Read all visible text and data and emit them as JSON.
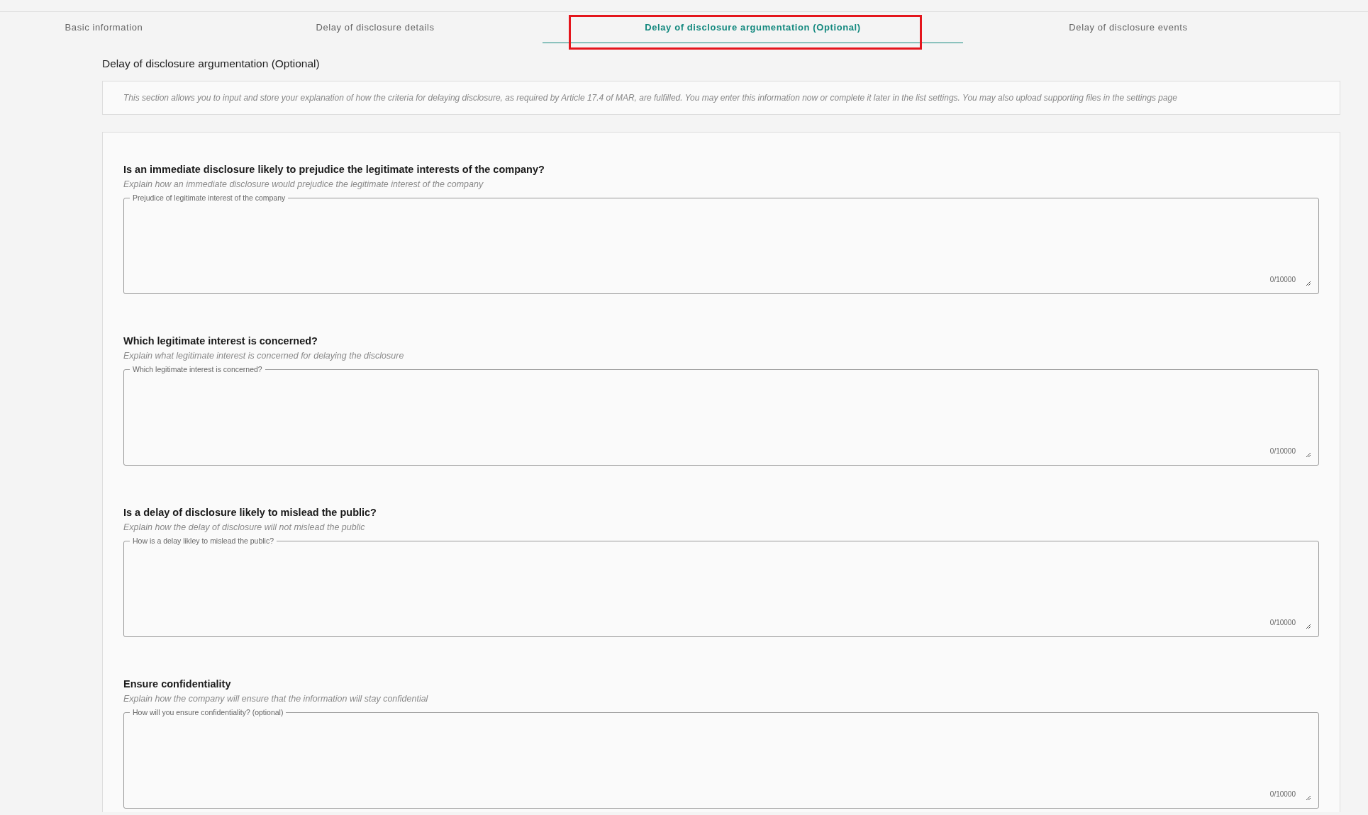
{
  "tabs": [
    {
      "label": "Basic information",
      "selected": false,
      "annotated": false
    },
    {
      "label": "Delay of disclosure details",
      "selected": false,
      "annotated": false
    },
    {
      "label": "Delay of disclosure argumentation (Optional)",
      "selected": true,
      "annotated": true
    },
    {
      "label": "Delay of disclosure events",
      "selected": false,
      "annotated": false
    }
  ],
  "section_title": "Delay of disclosure argumentation (Optional)",
  "info": "This section allows you to input and store your explanation of how the criteria for delaying disclosure, as required by Article 17.4 of MAR, are fulfilled. You may enter this information now or complete it later in the list settings. You may also upload supporting files in the settings page",
  "questions": [
    {
      "title": "Is an immediate disclosure likely to prejudice the legitimate interests of the company?",
      "hint": "Explain how an immediate disclosure would prejudice the legitimate interest of the company",
      "field_label": "Prejudice of legitimate interest of the company",
      "counter": "0/10000"
    },
    {
      "title": "Which legitimate interest is concerned?",
      "hint": "Explain what legitimate interest is concerned for delaying the disclosure",
      "field_label": "Which legitimate interest is concerned?",
      "counter": "0/10000"
    },
    {
      "title": "Is a delay of disclosure likely to mislead the public?",
      "hint": "Explain how the delay of disclosure will not mislead the public",
      "field_label": "How is a delay likley to mislead the public?",
      "counter": "0/10000"
    },
    {
      "title": "Ensure confidentiality",
      "hint": "Explain how the company will ensure that the information will stay confidential",
      "field_label": "How will you ensure confidentiality? (optional)",
      "counter": "0/10000"
    }
  ]
}
